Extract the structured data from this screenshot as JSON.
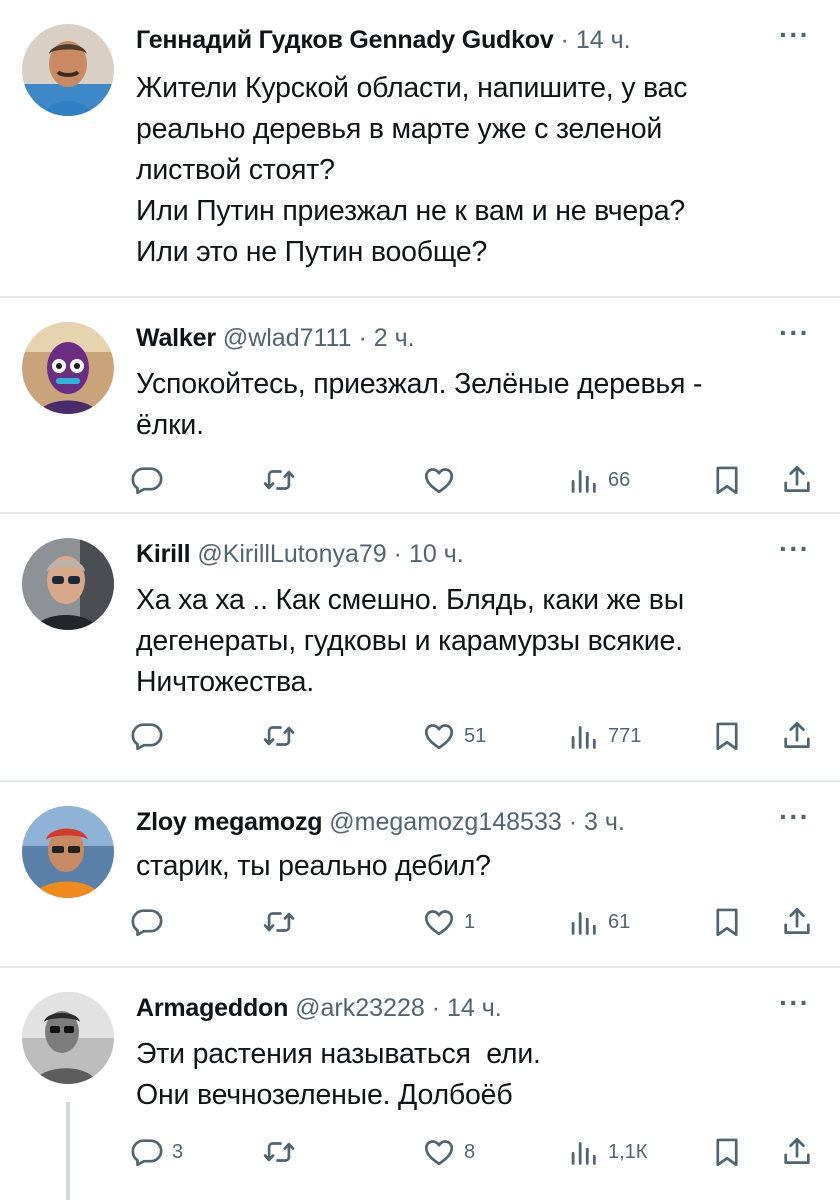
{
  "tweets": [
    {
      "name": "Геннадий Гудков Gennady Gudkov",
      "handle": "",
      "sep": "·",
      "time": "14 ч.",
      "more": "···",
      "lines": [
        "Жители Курской области, напишите, у вас",
        "реально деревья в марте уже с зеленой",
        "листвой стоят?",
        "Или Путин приезжал не к вам и не вчера?",
        "Или это не Путин вообще?"
      ]
    },
    {
      "name": "Walker",
      "handle": "@wlad7111",
      "sep": "·",
      "time": "2 ч.",
      "more": "···",
      "lines": [
        "Успокойтесь, приезжал. Зелёные деревья -",
        "ёлки."
      ],
      "counts": {
        "reply": "",
        "retweet": "",
        "like": "",
        "views": "66"
      }
    },
    {
      "name": "Kirill",
      "handle": "@KirillLutonya79",
      "sep": "·",
      "time": "10 ч.",
      "more": "···",
      "lines": [
        "Ха ха ха .. Как смешно. Блядь, каки же вы",
        "дегенераты, гудковы и карамурзы всякие.",
        "Ничтожества."
      ],
      "counts": {
        "reply": "",
        "retweet": "",
        "like": "51",
        "views": "771"
      }
    },
    {
      "name": "Zloy megamozg",
      "handle": "@megamozg148533",
      "sep": "·",
      "time": "3 ч.",
      "more": "···",
      "lines": [
        "старик, ты реально дебил?"
      ],
      "counts": {
        "reply": "",
        "retweet": "",
        "like": "1",
        "views": "61"
      }
    },
    {
      "name": "Armageddon",
      "handle": "@ark23228",
      "sep": "·",
      "time": "14 ч.",
      "more": "···",
      "lines": [
        "Эти растения называться  ели.",
        "Они вечнозеленые. Долбоёб"
      ],
      "counts": {
        "reply": "3",
        "retweet": "",
        "like": "8",
        "views": "1,1К"
      }
    }
  ],
  "icons": {
    "reply": "reply-icon",
    "retweet": "retweet-icon",
    "like": "like-icon",
    "views": "views-icon",
    "bookmark": "bookmark-icon",
    "share": "share-icon"
  },
  "colors": {
    "text": "#0f1419",
    "muted": "#536471",
    "divider": "#e6e9eb"
  }
}
